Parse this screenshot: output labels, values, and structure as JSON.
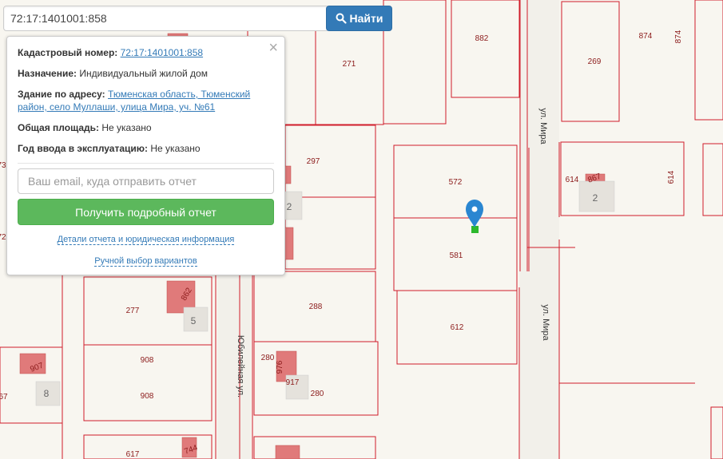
{
  "search": {
    "value": "72:17:1401001:858",
    "button_label": "Найти"
  },
  "panel": {
    "cadastral_label": "Кадастровый номер:",
    "cadastral_value": "72:17:1401001:858",
    "purpose_label": "Назначение:",
    "purpose_value": "Индивидуальный жилой дом",
    "address_label": "Здание по адресу:",
    "address_value": "Тюменская область, Тюменский район, село Муллаши, улица Мира, уч. №61",
    "area_label": "Общая площадь:",
    "area_value": "Не указано",
    "year_label": "Год ввода в эксплуатацию:",
    "year_value": "Не указано",
    "email_placeholder": "Ваш email, куда отправить отчет",
    "report_button": "Получить подробный отчет",
    "details_link": "Детали отчета и юридическая информация",
    "manual_link": "Ручной выбор вариантов"
  },
  "map": {
    "plot_numbers": [
      "882",
      "874",
      "874",
      "269",
      "271",
      "297",
      "572",
      "581",
      "612",
      "614",
      "867",
      "614",
      "277",
      "862",
      "288",
      "280",
      "976",
      "917",
      "280",
      "907",
      "908",
      "908",
      "617",
      "744",
      "67",
      "73",
      "72"
    ],
    "house_numbers": [
      "2",
      "2",
      "5",
      "8"
    ],
    "streets": [
      "ул. Мира",
      "ул. Мира",
      "Юбилейная ул."
    ],
    "colors": {
      "boundary": "#d01c2a",
      "building_fill": "#e07a7a",
      "plot_text": "#8b1a1a",
      "marker": "#2a86d1",
      "selected": "#2db82d"
    }
  }
}
